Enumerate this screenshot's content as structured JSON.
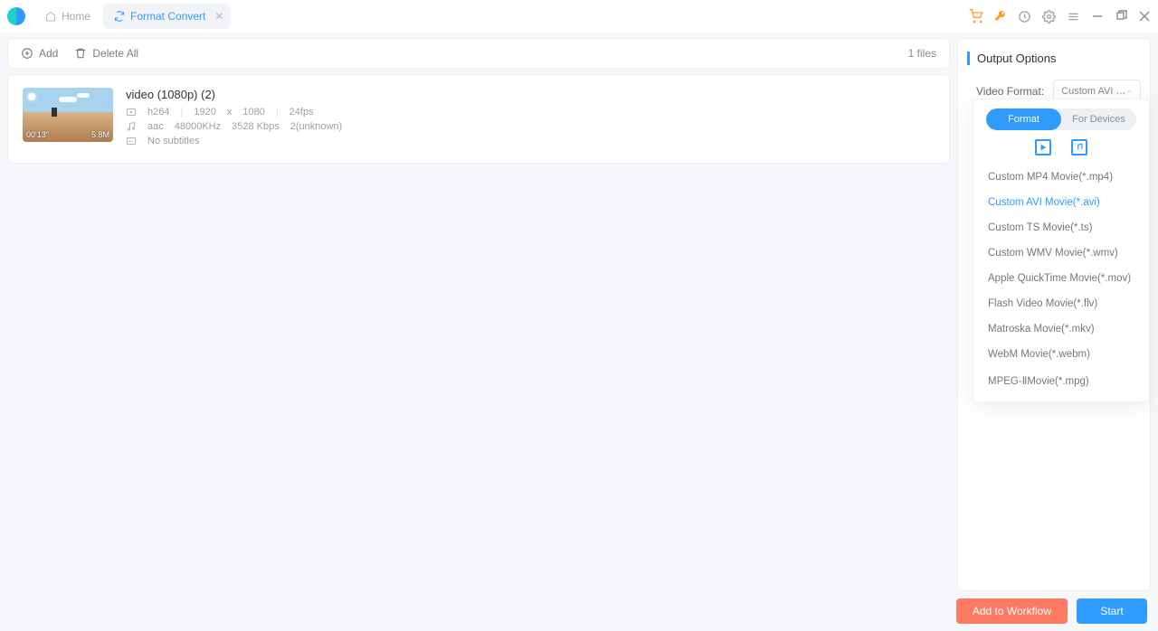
{
  "titlebar": {
    "home_label": "Home",
    "active_tab_label": "Format Convert"
  },
  "toolbar": {
    "add_label": "Add",
    "delete_all_label": "Delete All",
    "file_count": "1 files"
  },
  "file": {
    "title": "video (1080p) (2)",
    "codec": "h264",
    "width": "1920",
    "x": "x",
    "height": "1080",
    "fps": "24fps",
    "audio_codec": "aac",
    "audio_rate": "48000KHz",
    "audio_bitrate": "3528 Kbps",
    "audio_channels": "2(unknown)",
    "subtitles": "No subtitles",
    "duration": "00'13\"",
    "size": "5.8M"
  },
  "output": {
    "title": "Output Options",
    "video_format_label": "Video Format:",
    "video_format_value": "Custom AVI Movie(*....",
    "toggle_format": "Format",
    "toggle_devices": "For Devices",
    "options": [
      "Custom MP4 Movie(*.mp4)",
      "Custom AVI Movie(*.avi)",
      "Custom TS Movie(*.ts)",
      "Custom WMV Movie(*.wmv)",
      "Apple QuickTime Movie(*.mov)",
      "Flash Video Movie(*.flv)",
      "Matroska Movie(*.mkv)",
      "WebM Movie(*.webm)",
      "MPEG-ⅡMovie(*.mpg)"
    ],
    "selected_index": 1
  },
  "buttons": {
    "add_workflow": "Add to Workflow",
    "start": "Start"
  }
}
